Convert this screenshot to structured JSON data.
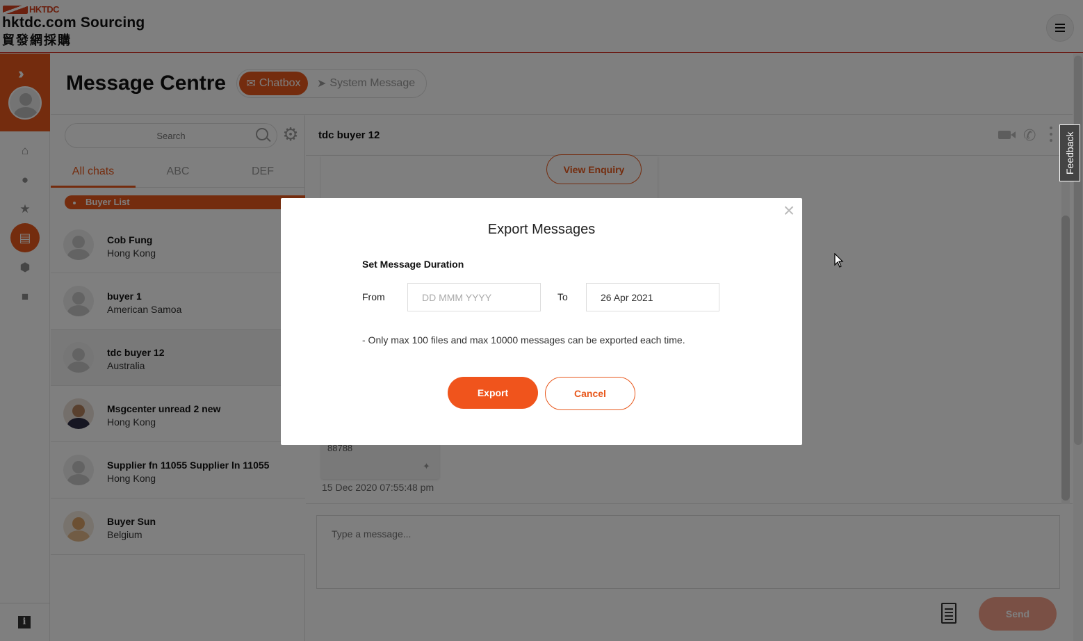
{
  "header": {
    "logo_brand": "HKTDC",
    "logo_title": "hktdc.com Sourcing",
    "logo_subtitle": "貿發網採購",
    "menu_icon": "hamburger-icon"
  },
  "rail": {
    "icons": [
      "double-chevron-right-icon",
      "avatar-icon",
      "home-icon",
      "user-icon",
      "star-icon",
      "chat-icon",
      "cube-icon",
      "document-icon",
      "info-icon"
    ],
    "info_label": "i"
  },
  "page": {
    "title": "Message Centre",
    "tabs": [
      {
        "label": "Chatbox",
        "icon": "mail-icon",
        "active": true
      },
      {
        "label": "System Message",
        "icon": "megaphone-icon",
        "active": false
      }
    ]
  },
  "chat_list": {
    "search_placeholder": "Search",
    "filter_tabs": [
      {
        "label": "All chats",
        "active": true
      },
      {
        "label": "ABC",
        "active": false
      },
      {
        "label": "DEF",
        "active": false
      }
    ],
    "section_label": "Buyer List",
    "items": [
      {
        "name": "Cob Fung",
        "location": "Hong Kong",
        "selected": false
      },
      {
        "name": "buyer 1",
        "location": "American Samoa",
        "selected": false
      },
      {
        "name": "tdc buyer 12",
        "location": "Australia",
        "selected": true
      },
      {
        "name": "Msgcenter unread 2 new",
        "location": "Hong Kong",
        "selected": false
      },
      {
        "name": "Supplier fn 11055 Supplier ln 11055",
        "location": "Hong Kong",
        "selected": false
      },
      {
        "name": "Buyer Sun",
        "location": "Belgium",
        "selected": false
      }
    ]
  },
  "chat": {
    "contact_name": "tdc buyer 12",
    "view_enquiry_label": "View Enquiry",
    "message_snippet": "88788",
    "message_time": "15 Dec 2020 07:55:48 pm",
    "compose_placeholder": "Type a message...",
    "send_label": "Send",
    "feedback_label": "Feedback"
  },
  "modal": {
    "title": "Export Messages",
    "subhead": "Set Message Duration",
    "from_label": "From",
    "from_placeholder": "DD MMM YYYY",
    "to_label": "To",
    "to_value": "26 Apr 2021",
    "note": "- Only max 100 files and max 10000 messages can be exported each time.",
    "export_label": "Export",
    "cancel_label": "Cancel",
    "close_icon": "close-icon"
  },
  "colors": {
    "accent": "#e8581c",
    "overlay": "rgba(0,0,0,0.5)"
  }
}
